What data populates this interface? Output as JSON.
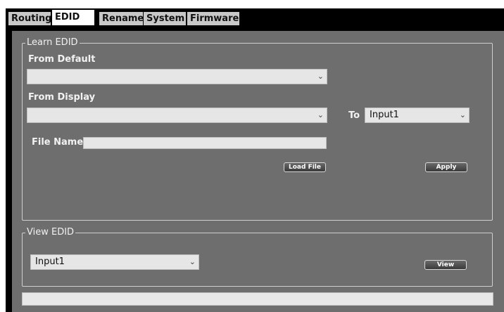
{
  "tabs": [
    {
      "label": "Routing"
    },
    {
      "label": "EDID"
    },
    {
      "label": "Rename"
    },
    {
      "label": "System"
    },
    {
      "label": "Firmware"
    }
  ],
  "learn": {
    "legend": "Learn EDID",
    "from_default_label": "From Default",
    "from_default_value": "",
    "from_display_label": "From Display",
    "from_display_value": "",
    "to_label": "To",
    "to_value": "Input1",
    "file_name_label": "File Name:",
    "file_name_value": "",
    "load_file_label": "Load File",
    "apply_label": "Apply"
  },
  "view": {
    "legend": "View EDID",
    "input_value": "Input1",
    "view_label": "View"
  },
  "icons": {
    "dropdown": "chevron-down-icon"
  }
}
